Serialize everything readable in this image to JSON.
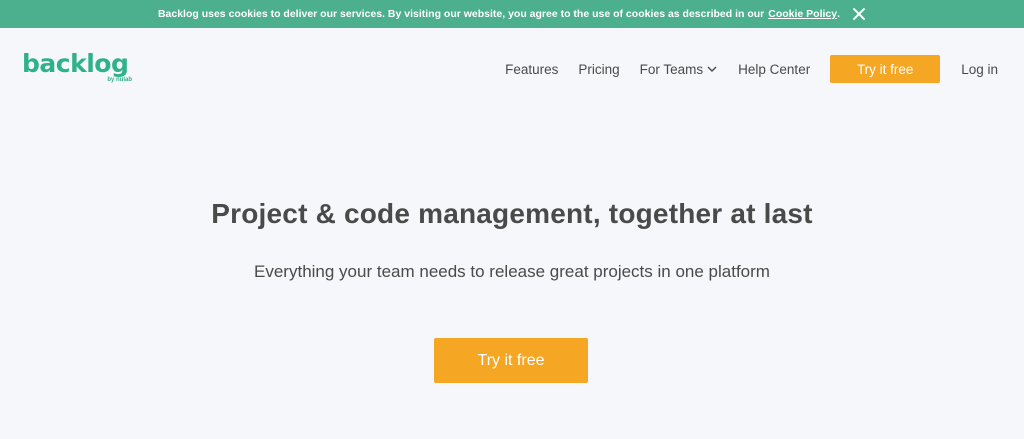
{
  "cookie_banner": {
    "text": "Backlog uses cookies to deliver our services. By visiting our website, you agree to the use of cookies as described in our",
    "link_text": "Cookie Policy",
    "period": ".",
    "close_icon": "close-icon"
  },
  "header": {
    "logo_word": "backlog",
    "logo_tagline": "by nulab",
    "nav": {
      "features": "Features",
      "pricing": "Pricing",
      "for_teams": "For Teams",
      "help_center": "Help Center",
      "try_free": "Try it free",
      "login": "Log in"
    }
  },
  "hero": {
    "title": "Project & code management, together at last",
    "subtitle": "Everything your team needs to release great projects in one platform",
    "cta": "Try it free"
  },
  "colors": {
    "brand_green": "#2fb28a",
    "cookie_green": "#4caf8e",
    "cta_orange": "#f5a623",
    "background": "#f5f7fa",
    "text": "#4a4a4a"
  }
}
